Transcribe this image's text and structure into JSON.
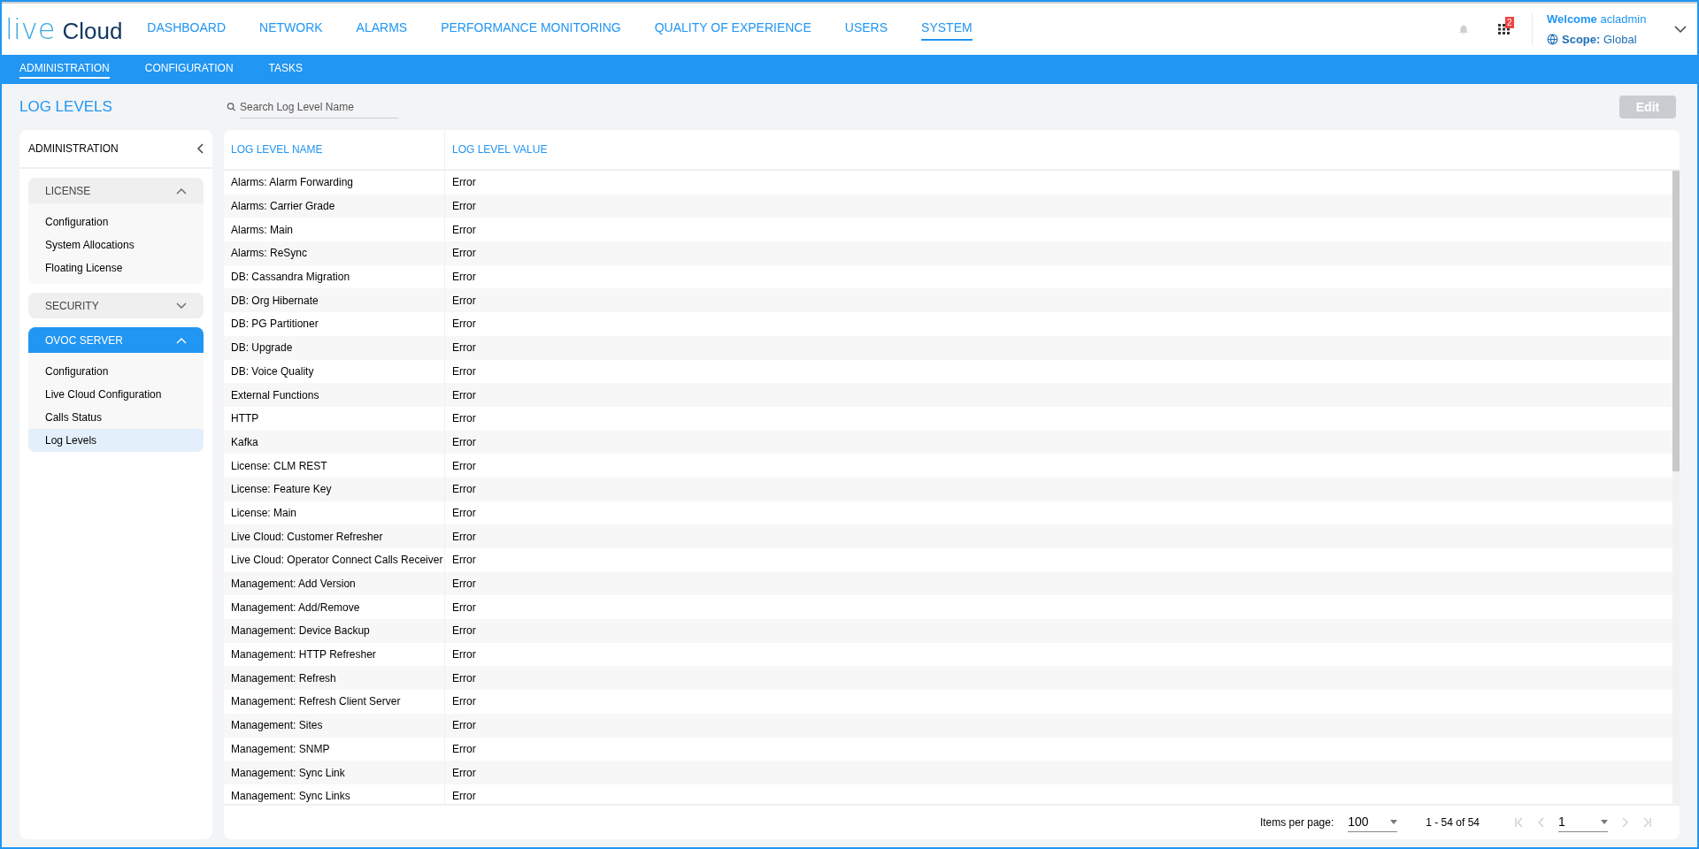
{
  "logo": {
    "part_1": "live",
    "part_2": "Cloud"
  },
  "main_nav": [
    {
      "label": "DASHBOARD",
      "selected": false
    },
    {
      "label": "NETWORK",
      "selected": false
    },
    {
      "label": "ALARMS",
      "selected": false
    },
    {
      "label": "PERFORMANCE MONITORING",
      "selected": false
    },
    {
      "label": "QUALITY OF EXPERIENCE",
      "selected": false
    },
    {
      "label": "USERS",
      "selected": false
    },
    {
      "label": "SYSTEM",
      "selected": true
    }
  ],
  "header": {
    "notification_count": "2",
    "welcome_label": "Welcome",
    "user": "acladmin",
    "scope_label": "Scope:",
    "scope": "Global"
  },
  "sub_nav": [
    {
      "label": "ADMINISTRATION",
      "selected": true
    },
    {
      "label": "CONFIGURATION",
      "selected": false
    },
    {
      "label": "TASKS",
      "selected": false
    }
  ],
  "page": {
    "title": "LOG LEVELS",
    "search_placeholder": "Search Log Level Name",
    "edit_button": "Edit",
    "edit_disabled": true
  },
  "sidebar": {
    "title": "ADMINISTRATION",
    "sections": [
      {
        "label": "LICENSE",
        "expanded": true,
        "selected": false,
        "items": [
          {
            "label": "Configuration",
            "selected": false
          },
          {
            "label": "System Allocations",
            "selected": false
          },
          {
            "label": "Floating License",
            "selected": false
          }
        ]
      },
      {
        "label": "SECURITY",
        "expanded": false,
        "selected": false
      },
      {
        "label": "OVOC SERVER",
        "expanded": true,
        "selected": true,
        "items": [
          {
            "label": "Configuration",
            "selected": false
          },
          {
            "label": "Live Cloud Configuration",
            "selected": false
          },
          {
            "label": "Calls Status",
            "selected": false
          },
          {
            "label": "Log Levels",
            "selected": true
          }
        ]
      }
    ]
  },
  "table": {
    "columns": [
      "LOG LEVEL NAME",
      "LOG LEVEL VALUE"
    ],
    "rows": [
      [
        "Alarms: Alarm Forwarding",
        "Error"
      ],
      [
        "Alarms: Carrier Grade",
        "Error"
      ],
      [
        "Alarms: Main",
        "Error"
      ],
      [
        "Alarms: ReSync",
        "Error"
      ],
      [
        "DB: Cassandra Migration",
        "Error"
      ],
      [
        "DB: Org Hibernate",
        "Error"
      ],
      [
        "DB: PG Partitioner",
        "Error"
      ],
      [
        "DB: Upgrade",
        "Error"
      ],
      [
        "DB: Voice Quality",
        "Error"
      ],
      [
        "External Functions",
        "Error"
      ],
      [
        "HTTP",
        "Error"
      ],
      [
        "Kafka",
        "Error"
      ],
      [
        "License: CLM REST",
        "Error"
      ],
      [
        "License: Feature Key",
        "Error"
      ],
      [
        "License: Main",
        "Error"
      ],
      [
        "Live Cloud: Customer Refresher",
        "Error"
      ],
      [
        "Live Cloud: Operator Connect Calls Receiver",
        "Error"
      ],
      [
        "Management: Add Version",
        "Error"
      ],
      [
        "Management: Add/Remove",
        "Error"
      ],
      [
        "Management: Device Backup",
        "Error"
      ],
      [
        "Management: HTTP Refresher",
        "Error"
      ],
      [
        "Management: Refresh",
        "Error"
      ],
      [
        "Management: Refresh Client Server",
        "Error"
      ],
      [
        "Management: Sites",
        "Error"
      ],
      [
        "Management: SNMP",
        "Error"
      ],
      [
        "Management: Sync Link",
        "Error"
      ],
      [
        "Management: Sync Links",
        "Error"
      ]
    ]
  },
  "pagination": {
    "items_per_page_label": "Items per page:",
    "items_per_page": "100",
    "range": "1 - 54 of 54",
    "page": "1"
  }
}
